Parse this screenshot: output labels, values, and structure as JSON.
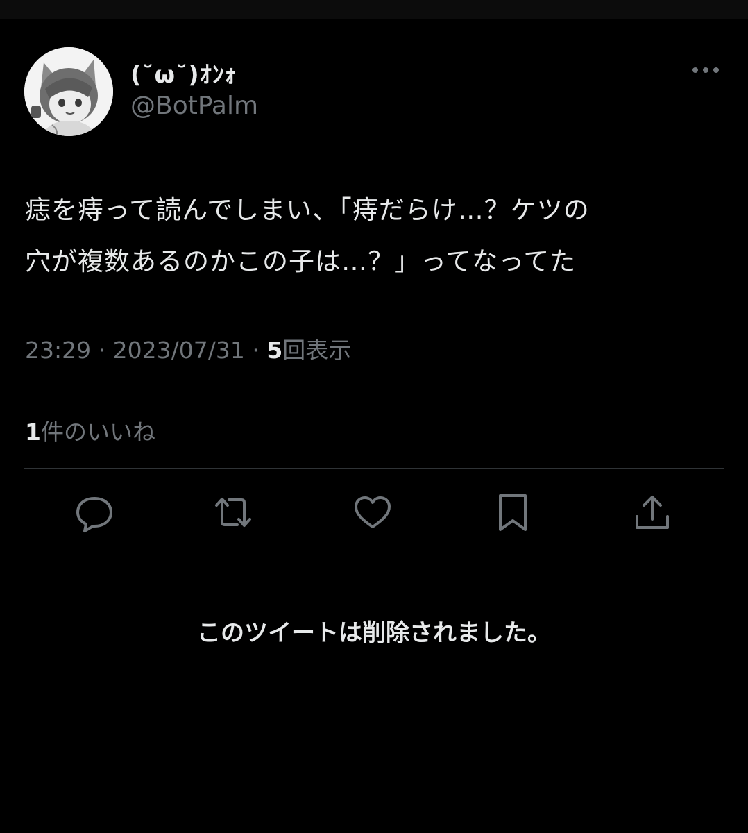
{
  "tweet": {
    "author": {
      "display_name": "(˘ω˘)ｵﾝｫ",
      "handle": "@BotPalm",
      "avatar_icon": "avatar-image"
    },
    "text_lines": [
      "痣を痔って読んでしまい、「痔だらけ…？ケツの",
      "穴が複数あるのかこの子は…？」ってなってた"
    ],
    "meta": {
      "time": "23:29",
      "separator": "·",
      "date": "2023/07/31",
      "views_count": "5",
      "views_label": "回表示"
    },
    "likes": {
      "count": "1",
      "label": "件のいいね"
    },
    "actions": [
      {
        "name": "reply",
        "icon": "reply-icon"
      },
      {
        "name": "retweet",
        "icon": "retweet-icon"
      },
      {
        "name": "like",
        "icon": "heart-icon"
      },
      {
        "name": "bookmark",
        "icon": "bookmark-icon"
      },
      {
        "name": "share",
        "icon": "share-icon"
      }
    ],
    "more_icon": "more-horizontal-icon"
  },
  "deleted_notice": "このツイートは削除されました。",
  "colors": {
    "background": "#000000",
    "primary_text": "#e7e9ea",
    "secondary_text": "#71767b",
    "divider": "#2f3336"
  }
}
